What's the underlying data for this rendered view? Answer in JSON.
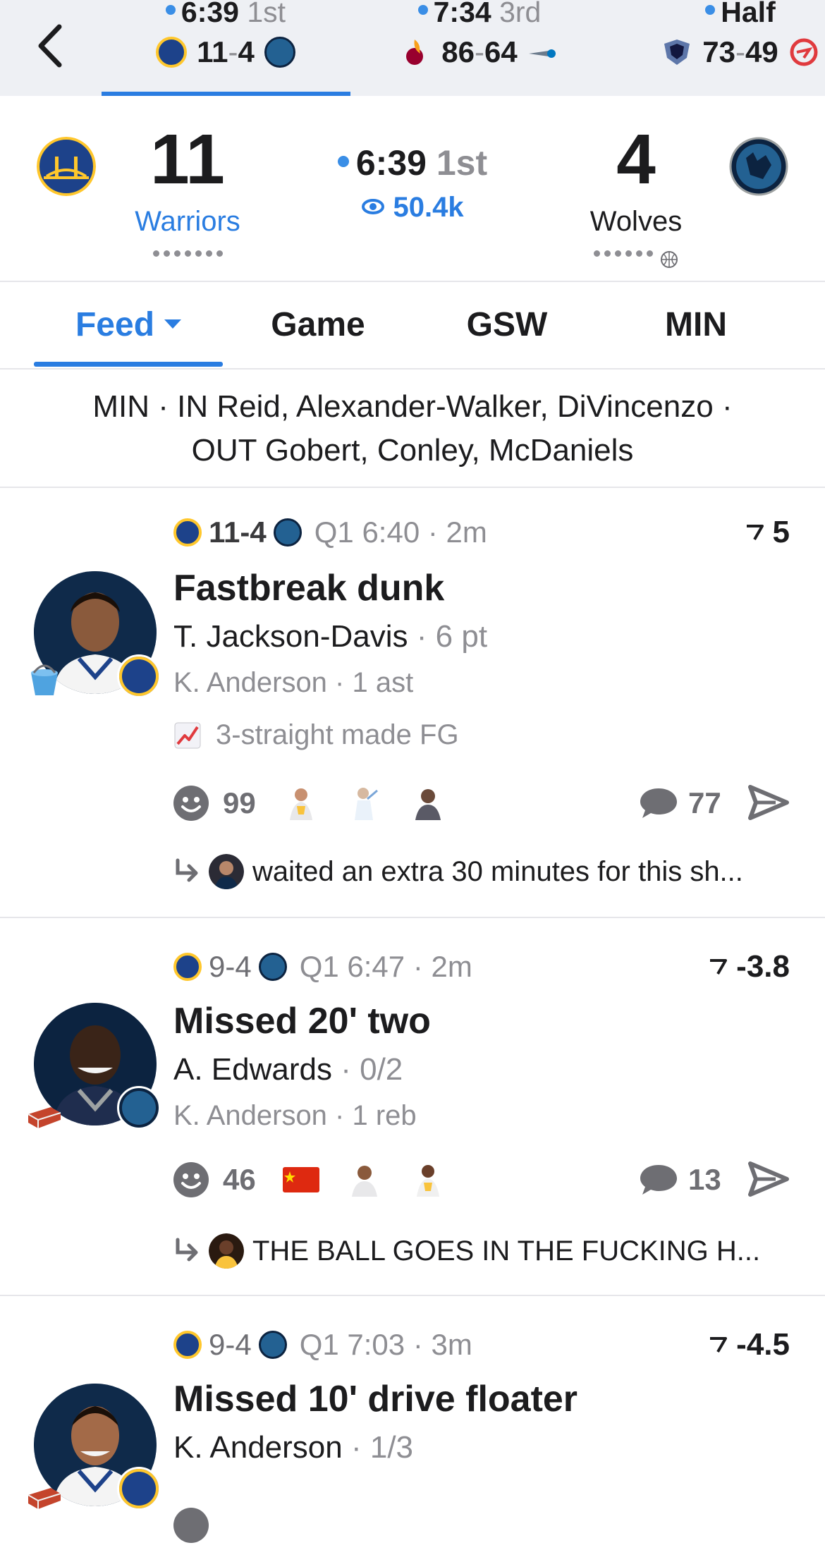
{
  "top_games": [
    {
      "clock": "6:39",
      "period": "1st",
      "away_score": "11",
      "home_score": "4",
      "away_color": "#1d428a",
      "home_color": "#236192"
    },
    {
      "clock": "7:34",
      "period": "3rd",
      "away_score": "86",
      "home_score": "64",
      "away_color": "#98002e",
      "home_color": "#0077c0"
    },
    {
      "clock": "Half",
      "period": "",
      "away_score": "73",
      "home_score": "49",
      "away_color": "#5d76a9",
      "home_color": "#e03a3e"
    }
  ],
  "scoreboard": {
    "away": {
      "score": "11",
      "name": "Warriors",
      "name_color": "#2a7de1",
      "primary": "#1d428a",
      "secondary": "#ffc72c"
    },
    "home": {
      "score": "4",
      "name": "Wolves",
      "primary": "#0c2340",
      "secondary": "#78be20"
    },
    "clock": "6:39",
    "period": "1st",
    "viewers": "50.4k"
  },
  "tabs": [
    {
      "label": "Feed",
      "active": true
    },
    {
      "label": "Game",
      "active": false
    },
    {
      "label": "GSW",
      "active": false
    },
    {
      "label": "MIN",
      "active": false
    }
  ],
  "subs": {
    "line1": "MIN · IN Reid, Alexander-Walker, DiVincenzo ·",
    "line2": "OUT Gobert, Conley, McDaniels"
  },
  "feed": [
    {
      "score": "11-4",
      "time": "Q1 6:40 · 2m",
      "trend": "5",
      "title": "Fastbreak dunk",
      "player": "T. Jackson-Davis",
      "player_stat": "6 pt",
      "assist_player": "K. Anderson",
      "assist_stat": "1 ast",
      "streak": "3-straight made FG",
      "reactions": "99",
      "comments": "77",
      "reply": "waited an extra 30 minutes for this sh..."
    },
    {
      "score": "9-4",
      "time": "Q1 6:47 · 2m",
      "trend": "-3.8",
      "title": "Missed 20' two",
      "player": "A. Edwards",
      "player_stat": "0/2",
      "assist_player": "K. Anderson",
      "assist_stat": "1 reb",
      "reactions": "46",
      "comments": "13",
      "reply": "THE BALL GOES IN THE FUCKING H..."
    },
    {
      "score": "9-4",
      "time": "Q1 7:03 · 3m",
      "trend": "-4.5",
      "title": "Missed 10' drive floater",
      "player": "K. Anderson",
      "player_stat": "1/3"
    }
  ]
}
